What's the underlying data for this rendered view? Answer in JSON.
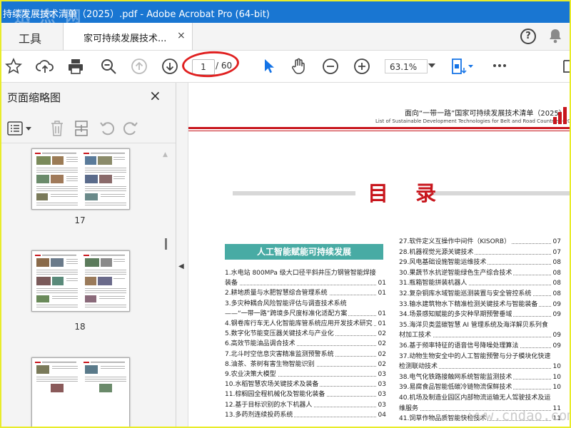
{
  "window": {
    "title": "持续发展技术清单（2025）.pdf - Adobe Acrobat Pro (64-bit)",
    "watermark": "迅 杰 网"
  },
  "tabs": {
    "tools_label": "工具",
    "doc_label": "家可持续发展技术...",
    "close": "×"
  },
  "toolbar": {
    "page_current": "1",
    "page_total": "/ 60",
    "zoom": "63.1%"
  },
  "left_pane": {
    "title": "页面缩略图",
    "close": "×",
    "thumb_labels": [
      "17",
      "18"
    ]
  },
  "document": {
    "header_cn": "面向“一带一路”国家可持续发展技术清单（2025）",
    "header_en": "List of Sustainable Development Technologies for Belt and Road Countries (2025)",
    "mulu": "目 录",
    "section": "人工智能赋能可持续发展",
    "toc_left": [
      {
        "text": "1.水电站 800MPa 级大口径平斜井压力钢管智能焊接",
        "page": ""
      },
      {
        "text": "   装备",
        "page": "01"
      },
      {
        "text": "2.耕地质量与水肥智慧综合管理系统",
        "page": "01"
      },
      {
        "text": "3.多灾种耦合风险智能评估与调查技术系统",
        "page": ""
      },
      {
        "text": "   ——“一带一路”跨境多尺度标准化适配方案",
        "page": "01"
      },
      {
        "text": "4.钢卷库行车无人化智能库管系统应用开发技术研究",
        "page": "01"
      },
      {
        "text": "5.数字化节能变压器关键技术与产业化",
        "page": "02"
      },
      {
        "text": "6.高效节能油品调合技术",
        "page": "02"
      },
      {
        "text": "7.北斗时空信息灾害精准监测预警系统",
        "page": "02"
      },
      {
        "text": "8.油茶、茶树有害生物智能识别",
        "page": "02"
      },
      {
        "text": "9.农业决策大模型",
        "page": "03"
      },
      {
        "text": "10.水稻智慧农场关键技术及装备",
        "page": "03"
      },
      {
        "text": "11.棕榈园全程机械化及智能化装备",
        "page": "03"
      },
      {
        "text": "12.基于目标识别的水下机器人",
        "page": "03"
      },
      {
        "text": "13.多药剂连续投药系统",
        "page": "04"
      }
    ],
    "toc_right": [
      {
        "text": "27.软件定义互操作中间件（KISORB）",
        "page": "07"
      },
      {
        "text": "28.机器视觉光源关键技术",
        "page": "07"
      },
      {
        "text": "29.风电基础设施智能运维技术",
        "page": "08"
      },
      {
        "text": "30.果蔬节水抗逆智能绿色生产综合技术",
        "page": "08"
      },
      {
        "text": "31.瓶箱智能拼装机器人",
        "page": "08"
      },
      {
        "text": "32.复杂铜库水域智能巡测装置与安全管控系统",
        "page": "08"
      },
      {
        "text": "33.输水建筑物水下精准检测关键技术与智能装备",
        "page": "09"
      },
      {
        "text": "34.场景感知赋能的多灾种早期预警垂域",
        "page": "09"
      },
      {
        "text": "35.海洋贝类蓝碳智慧 AI 管理系统及海洋解贝系列食",
        "page": ""
      },
      {
        "text": "   材加工技术",
        "page": "09"
      },
      {
        "text": "36.基于频率特征的语音信号降噪处理算法",
        "page": "09"
      },
      {
        "text": "37.动物生物安全中的人工智能预警与分子模块化快速",
        "page": ""
      },
      {
        "text": "   检测联动技术",
        "page": "10"
      },
      {
        "text": "38.电气化铁路接触网系统智能监测技术",
        "page": "10"
      },
      {
        "text": "39.易腐食品智能低碳冷链物流保鲜技术",
        "page": "10"
      },
      {
        "text": "40.机场及制造业园区内部物流运输无人驾驶技术及运",
        "page": ""
      },
      {
        "text": "   维服务",
        "page": "11"
      },
      {
        "text": "41.饲草作物品质智能快检技术",
        "page": "11"
      }
    ],
    "site_watermark": "www.cndao.com"
  },
  "colors": {
    "titlebar": "#1976d2",
    "accent_red": "#c8161d",
    "section_teal": "#48aba4",
    "select_blue": "#1473e6"
  }
}
